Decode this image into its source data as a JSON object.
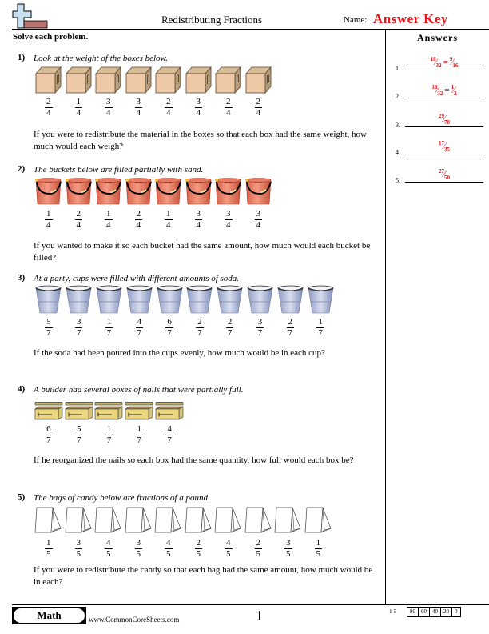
{
  "header": {
    "title": "Redistributing Fractions",
    "name_label": "Name:",
    "answer_key": "Answer Key",
    "accent_color": "#e8151b"
  },
  "instructions": "Solve each problem.",
  "answers": {
    "title": "Answers",
    "items": [
      {
        "num": "1.",
        "parts": [
          {
            "n": "18",
            "d": "32"
          },
          {
            "n": "9",
            "d": "16"
          }
        ]
      },
      {
        "num": "2.",
        "parts": [
          {
            "n": "16",
            "d": "32"
          },
          {
            "n": "1",
            "d": "2"
          }
        ]
      },
      {
        "num": "3.",
        "parts": [
          {
            "n": "29",
            "d": "70"
          }
        ]
      },
      {
        "num": "4.",
        "parts": [
          {
            "n": "17",
            "d": "35"
          }
        ]
      },
      {
        "num": "5.",
        "parts": [
          {
            "n": "27",
            "d": "50"
          }
        ]
      }
    ]
  },
  "problems": [
    {
      "num": "1)",
      "intro": "Look at the weight of the boxes below.",
      "icon": "cardboard-box",
      "fractions": [
        [
          "2",
          "4"
        ],
        [
          "1",
          "4"
        ],
        [
          "3",
          "4"
        ],
        [
          "3",
          "4"
        ],
        [
          "2",
          "4"
        ],
        [
          "3",
          "4"
        ],
        [
          "2",
          "4"
        ],
        [
          "2",
          "4"
        ]
      ],
      "question": "If you were to redistribute the material in the boxes so that each box had the same weight, how much would each weigh?"
    },
    {
      "num": "2)",
      "intro": "The buckets below are filled partially with sand.",
      "icon": "bucket",
      "fractions": [
        [
          "1",
          "4"
        ],
        [
          "2",
          "4"
        ],
        [
          "1",
          "4"
        ],
        [
          "2",
          "4"
        ],
        [
          "1",
          "4"
        ],
        [
          "3",
          "4"
        ],
        [
          "3",
          "4"
        ],
        [
          "3",
          "4"
        ]
      ],
      "question": "If you wanted to make it so each bucket had the same amount, how much would each bucket be filled?"
    },
    {
      "num": "3)",
      "intro": "At a party, cups were filled with different amounts of soda.",
      "icon": "cup",
      "fractions": [
        [
          "5",
          "7"
        ],
        [
          "3",
          "7"
        ],
        [
          "1",
          "7"
        ],
        [
          "4",
          "7"
        ],
        [
          "6",
          "7"
        ],
        [
          "2",
          "7"
        ],
        [
          "2",
          "7"
        ],
        [
          "3",
          "7"
        ],
        [
          "2",
          "7"
        ],
        [
          "1",
          "7"
        ]
      ],
      "question": "If the soda had been poured into the cups evenly, how much would be in each cup?"
    },
    {
      "num": "4)",
      "intro": "A builder had several boxes of nails that were partially full.",
      "icon": "nail-box",
      "fractions": [
        [
          "6",
          "7"
        ],
        [
          "5",
          "7"
        ],
        [
          "1",
          "7"
        ],
        [
          "1",
          "7"
        ],
        [
          "4",
          "7"
        ]
      ],
      "question": "If he reorganized the nails so each box had the same quantity, how full would each box be?"
    },
    {
      "num": "5)",
      "intro": "The bags of candy below are fractions of a pound.",
      "icon": "candy-bag",
      "fractions": [
        [
          "1",
          "5"
        ],
        [
          "3",
          "5"
        ],
        [
          "4",
          "5"
        ],
        [
          "3",
          "5"
        ],
        [
          "4",
          "5"
        ],
        [
          "2",
          "5"
        ],
        [
          "4",
          "5"
        ],
        [
          "2",
          "5"
        ],
        [
          "3",
          "5"
        ],
        [
          "1",
          "5"
        ]
      ],
      "question": "If you were to redistribute the candy so that each bag had the same amount, how much would be in each?"
    }
  ],
  "footer": {
    "subject": "Math",
    "site": "www.CommonCoreSheets.com",
    "page": "1",
    "score_label": "1-5",
    "scores": [
      "80",
      "60",
      "40",
      "20",
      "0"
    ]
  }
}
